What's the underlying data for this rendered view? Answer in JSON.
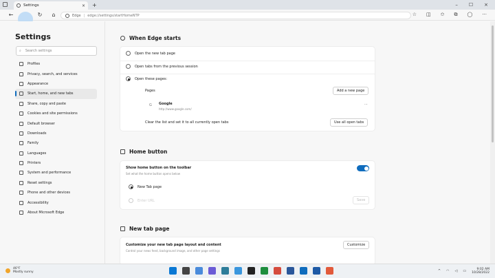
{
  "window": {
    "tab_title": "Settings",
    "tab_close": "×",
    "new_tab": "+",
    "minimize": "–",
    "maximize": "☐",
    "close": "×"
  },
  "addressbar": {
    "back": "←",
    "reload": "↻",
    "home": "⌂",
    "site": "Edge",
    "separator": "|",
    "url": "edge://settings/startHomeNTP"
  },
  "sidebar": {
    "title": "Settings",
    "search_placeholder": "Search settings",
    "items": [
      {
        "label": "Profiles",
        "icon": "person-icon"
      },
      {
        "label": "Privacy, search, and services",
        "icon": "lock-icon"
      },
      {
        "label": "Appearance",
        "icon": "brush-icon"
      },
      {
        "label": "Start, home, and new tabs",
        "icon": "home-icon",
        "active": true
      },
      {
        "label": "Share, copy and paste",
        "icon": "share-icon"
      },
      {
        "label": "Cookies and site permissions",
        "icon": "cookie-icon"
      },
      {
        "label": "Default browser",
        "icon": "browser-icon"
      },
      {
        "label": "Downloads",
        "icon": "download-icon"
      },
      {
        "label": "Family",
        "icon": "family-icon"
      },
      {
        "label": "Languages",
        "icon": "language-icon"
      },
      {
        "label": "Printers",
        "icon": "printer-icon"
      },
      {
        "label": "System and performance",
        "icon": "system-icon"
      },
      {
        "label": "Reset settings",
        "icon": "reset-icon"
      },
      {
        "label": "Phone and other devices",
        "icon": "phone-icon"
      },
      {
        "label": "Accessibility",
        "icon": "accessibility-icon"
      },
      {
        "label": "About Microsoft Edge",
        "icon": "edge-icon"
      }
    ]
  },
  "when_edge_starts": {
    "title": "When Edge starts",
    "options": [
      {
        "label": "Open the new tab page",
        "selected": false
      },
      {
        "label": "Open tabs from the previous session",
        "selected": false
      },
      {
        "label": "Open these pages:",
        "selected": true
      }
    ],
    "pages_label": "Pages",
    "add_page_button": "Add a new page",
    "page": {
      "name": "Google",
      "url": "http://www.google.com/"
    },
    "more": "···",
    "clear_text": "Clear the list and set it to all currently open tabs",
    "use_all_tabs_button": "Use all open tabs"
  },
  "home_button": {
    "title": "Home button",
    "toggle_label": "Show home button on the toolbar",
    "toggle_desc": "Set what the home button opens below",
    "toggle_on": true,
    "options": [
      {
        "label": "New Tab page",
        "selected": true
      },
      {
        "label": "Enter URL",
        "selected": false
      }
    ],
    "save_button": "Save"
  },
  "new_tab_page": {
    "title": "New tab page",
    "customize_label": "Customize your new tab page layout and content",
    "customize_desc": "Control your news feed, background image, and other page settings",
    "customize_button": "Customize"
  },
  "taskbar": {
    "weather_temp": "46°F",
    "weather_desc": "Mostly sunny",
    "time": "9:02 AM",
    "date": "10/28/2022",
    "tray_chevron": "^",
    "app_colors": [
      "#0a78d4",
      "#444444",
      "#4a8bdb",
      "#6b5bd6",
      "#2d7d9a",
      "#3a96dd",
      "#222222",
      "#1e8e3e",
      "#d54b3d",
      "#2b579a",
      "#0f6cbd",
      "#1e5aa6",
      "#e25a3b"
    ]
  }
}
